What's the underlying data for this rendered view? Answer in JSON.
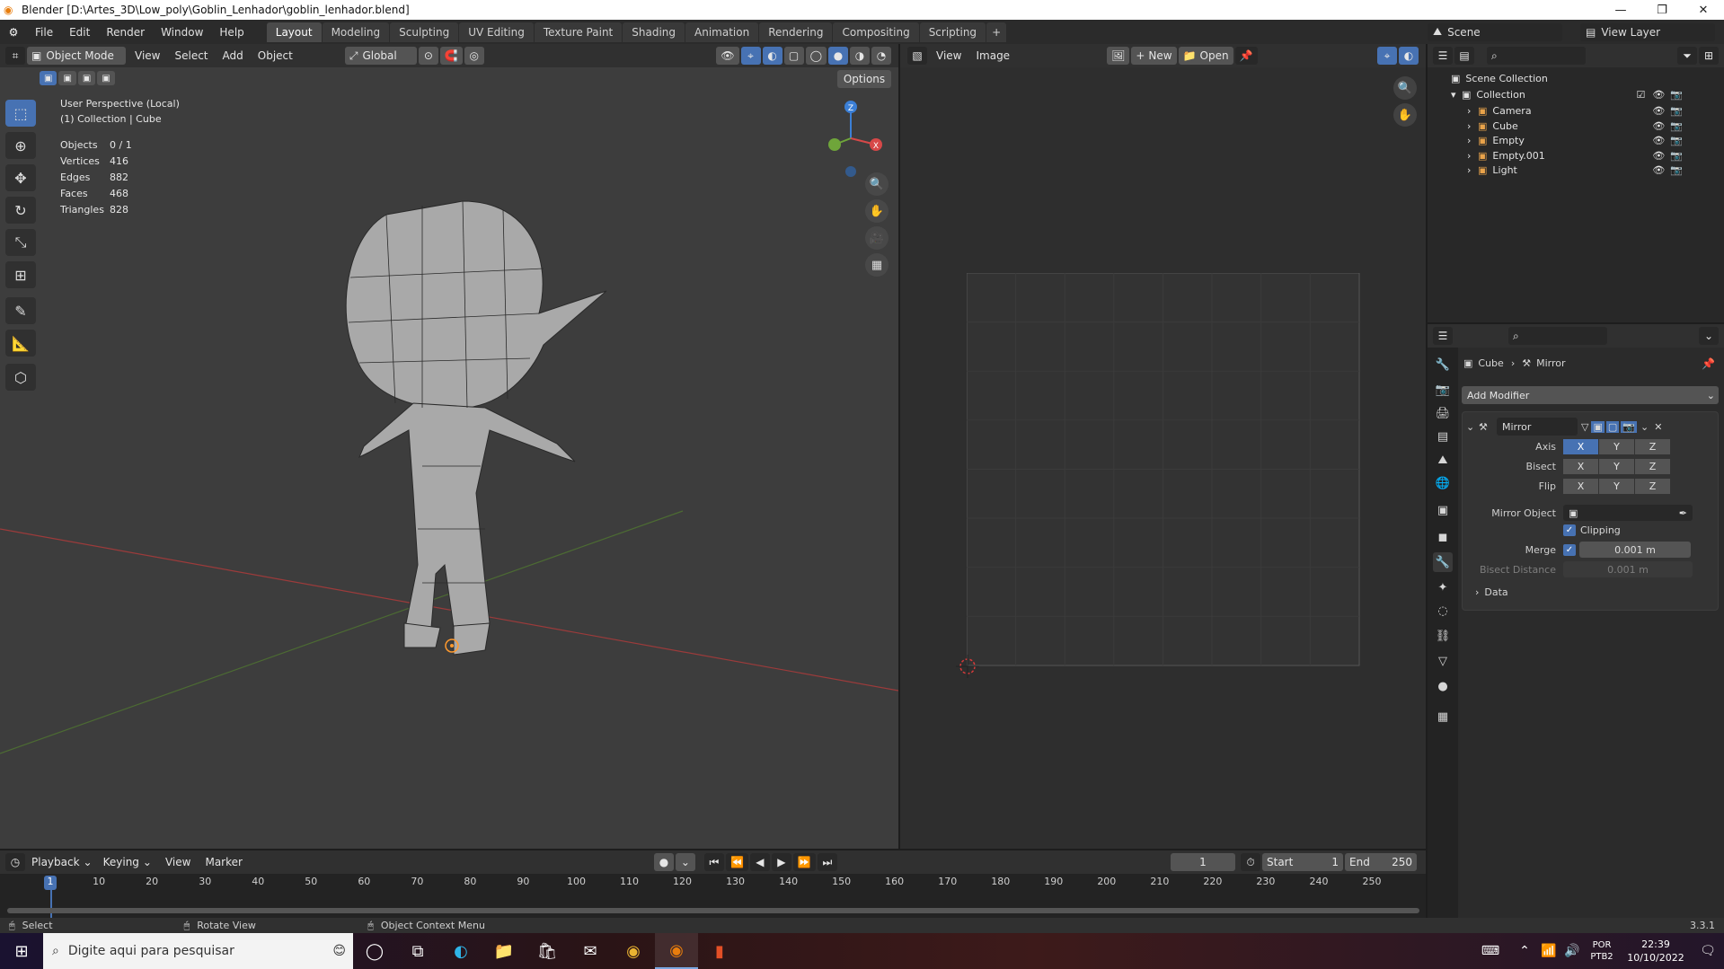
{
  "window": {
    "title": "Blender [D:\\Artes_3D\\Low_poly\\Goblin_Lenhador\\goblin_lenhador.blend]",
    "minimize": "—",
    "maximize": "❐",
    "close": "✕"
  },
  "menus": [
    "File",
    "Edit",
    "Render",
    "Window",
    "Help"
  ],
  "workspaces": [
    "Layout",
    "Modeling",
    "Sculpting",
    "UV Editing",
    "Texture Paint",
    "Shading",
    "Animation",
    "Rendering",
    "Compositing",
    "Scripting"
  ],
  "active_workspace": "Layout",
  "scene": {
    "name": "Scene",
    "view_layer": "View Layer"
  },
  "viewport": {
    "mode": "Object Mode",
    "menus": [
      "View",
      "Select",
      "Add",
      "Object"
    ],
    "orientation": "Global",
    "options_label": "Options",
    "overlay_title": "User Perspective (Local)",
    "overlay_sub": "(1) Collection | Cube",
    "stats": [
      {
        "label": "Objects",
        "value": "0 / 1"
      },
      {
        "label": "Vertices",
        "value": "416"
      },
      {
        "label": "Edges",
        "value": "882"
      },
      {
        "label": "Faces",
        "value": "468"
      },
      {
        "label": "Triangles",
        "value": "828"
      }
    ],
    "gizmo": {
      "z": "Z",
      "x": "X"
    }
  },
  "image_editor": {
    "menus": [
      "View",
      "Image"
    ],
    "new_label": "New",
    "open_label": "Open"
  },
  "outliner": {
    "root": "Scene Collection",
    "collection": "Collection",
    "items": [
      {
        "name": "Camera",
        "color": "#e9a34a"
      },
      {
        "name": "Cube",
        "color": "#e9a34a"
      },
      {
        "name": "Empty",
        "color": "#e9a34a"
      },
      {
        "name": "Empty.001",
        "color": "#e9a34a"
      },
      {
        "name": "Light",
        "color": "#e9a34a"
      }
    ]
  },
  "properties": {
    "breadcrumb_object": "Cube",
    "breadcrumb_modifier": "Mirror",
    "add_modifier": "Add Modifier",
    "modifier_name": "Mirror",
    "axis_label": "Axis",
    "bisect_label": "Bisect",
    "flip_label": "Flip",
    "axes": [
      "X",
      "Y",
      "Z"
    ],
    "mirror_object_label": "Mirror Object",
    "clipping_label": "Clipping",
    "merge_label": "Merge",
    "merge_value": "0.001 m",
    "bisect_distance_label": "Bisect Distance",
    "bisect_distance_value": "0.001 m",
    "data_label": "Data"
  },
  "timeline": {
    "menus": [
      "Playback",
      "Keying",
      "View",
      "Marker"
    ],
    "current_frame": "1",
    "start_label": "Start",
    "start_value": "1",
    "end_label": "End",
    "end_value": "250",
    "ticks": [
      "1",
      "10",
      "20",
      "30",
      "40",
      "50",
      "60",
      "70",
      "80",
      "90",
      "100",
      "110",
      "120",
      "130",
      "140",
      "150",
      "160",
      "170",
      "180",
      "190",
      "200",
      "210",
      "220",
      "230",
      "240",
      "250"
    ]
  },
  "statusbar": {
    "select": "Select",
    "rotate": "Rotate View",
    "context": "Object Context Menu",
    "version": "3.3.1"
  },
  "taskbar": {
    "search_placeholder": "Digite aqui para pesquisar",
    "lang": "POR",
    "lang2": "PTB2",
    "time": "22:39",
    "date": "10/10/2022"
  },
  "colors": {
    "accent": "#4772b3",
    "bg_viewport": "#3d3d3d",
    "bg_image": "#2e2e2e"
  }
}
